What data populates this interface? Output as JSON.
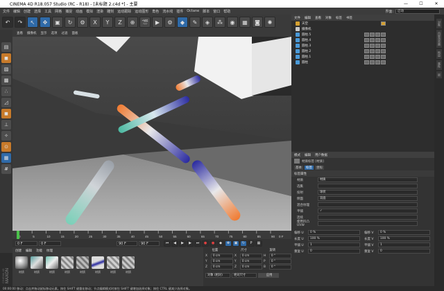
{
  "window": {
    "title": "CINEMA 4D R18.057 Studio (RC - R18) - [未标题 2.c4d *] - 主要"
  },
  "menu": [
    "文件",
    "编辑",
    "创建",
    "选择",
    "工具",
    "网格",
    "捕捉",
    "动画",
    "模拟",
    "渲染",
    "雕刻",
    "运动跟踪",
    "运动图形",
    "角色",
    "流水线",
    "插件",
    "Octane",
    "脚本",
    "窗口",
    "帮助"
  ],
  "layout": {
    "label": "界面:",
    "value": "启动"
  },
  "viewport_menu": [
    "查看",
    "摄像机",
    "显示",
    "选项",
    "过滤",
    "面板"
  ],
  "object_manager": {
    "tabs": [
      "文件",
      "编辑",
      "查看",
      "对象",
      "标签",
      "书签"
    ],
    "objects": [
      {
        "name": "天空",
        "color": "#d4a030"
      },
      {
        "name": "摄像机",
        "color": "#c9c9c9"
      },
      {
        "name": "圆柱.5",
        "color": "#4a9ad8"
      },
      {
        "name": "圆柱.4",
        "color": "#4a9ad8"
      },
      {
        "name": "圆柱.3",
        "color": "#4a9ad8"
      },
      {
        "name": "圆柱.2",
        "color": "#4a9ad8"
      },
      {
        "name": "圆柱.1",
        "color": "#4a9ad8"
      },
      {
        "name": "圆柱",
        "color": "#4a9ad8"
      }
    ]
  },
  "attributes": {
    "tabs": [
      "模式",
      "编辑",
      "用户数据"
    ],
    "title": "材质标签 [材质]",
    "subtabs": [
      "基本",
      "标签",
      "坐标"
    ],
    "section": "标签属性",
    "rows": [
      {
        "label": "材质",
        "value": "材质"
      },
      {
        "label": "选集",
        "value": ""
      },
      {
        "label": "投射",
        "value": "球状"
      },
      {
        "label": "侧面",
        "value": "双面"
      },
      {
        "label": "混合纹理",
        "value": ""
      },
      {
        "label": "平铺",
        "value": "✓"
      },
      {
        "label": "连续",
        "value": ""
      },
      {
        "label": "使用凹凸 UVW",
        "value": ""
      }
    ],
    "offsets": [
      {
        "label": "偏移 U",
        "value": "0 %"
      },
      {
        "label": "偏移 V",
        "value": "0 %"
      },
      {
        "label": "长度 U",
        "value": "100 %"
      },
      {
        "label": "长度 V",
        "value": "100 %"
      },
      {
        "label": "平铺 U",
        "value": "1"
      },
      {
        "label": "平铺 V",
        "value": "1"
      },
      {
        "label": "重复 U",
        "value": "0"
      },
      {
        "label": "重复 V",
        "value": "0"
      }
    ]
  },
  "timeline": {
    "ticks": [
      "0",
      "5",
      "10",
      "15",
      "20",
      "25",
      "30",
      "35",
      "40",
      "45",
      "50",
      "55",
      "60",
      "65",
      "70",
      "75",
      "80",
      "85",
      "90"
    ],
    "end_label": "0 F",
    "start_field": "0 F",
    "current_field": "0 F",
    "end_field": "90 F",
    "max_field": "90 F"
  },
  "materials": {
    "menu": [
      "创建",
      "编辑",
      "功能",
      "纹理"
    ],
    "names": [
      "材质",
      "材质",
      "材质",
      "材质",
      "材质",
      "材质",
      "材质",
      "材质"
    ]
  },
  "coords": {
    "headers": [
      "位置",
      "尺寸",
      "旋转"
    ],
    "rows": [
      {
        "axis": "X",
        "pos": "0 cm",
        "size": "0 cm",
        "rot_label": "H",
        "rot": "0 °"
      },
      {
        "axis": "Y",
        "pos": "0 cm",
        "size": "0 cm",
        "rot_label": "P",
        "rot": "0 °"
      },
      {
        "axis": "Z",
        "pos": "0 cm",
        "size": "0 cm",
        "rot_label": "B",
        "rot": "0 °"
      }
    ],
    "mode": "对象 (相对)",
    "size_mode": "绝对尺寸",
    "apply": "应用"
  },
  "status": "00:00:00    移动：点击并拖动鼠标移动元素。按住 SHIFT 键量化移动；节点编辑模式时按住 SHIFT 键增加选择对象；按住 CTRL 键减少选择对象。",
  "branding": {
    "maxon": "MAXON",
    "cinema": "CINEMA 4D"
  }
}
